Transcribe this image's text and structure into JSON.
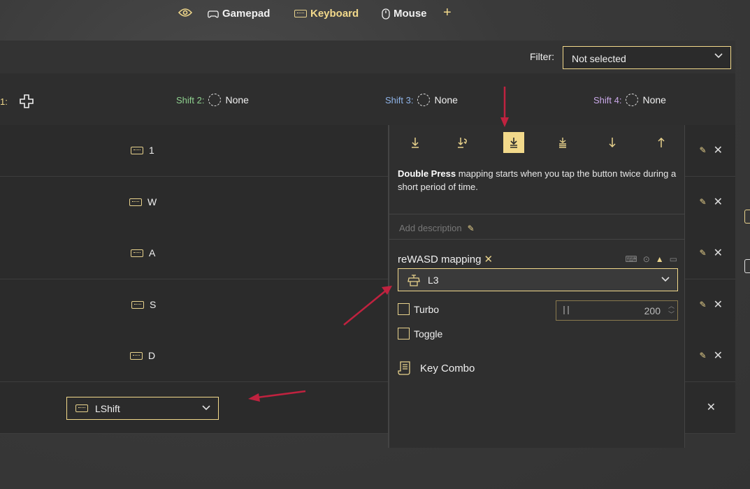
{
  "nav": {
    "items": [
      {
        "label": "Gamepad",
        "icon": "gamepad-icon"
      },
      {
        "label": "Keyboard",
        "icon": "keyboard-icon",
        "active": true
      },
      {
        "label": "Mouse",
        "icon": "mouse-icon"
      }
    ],
    "add_label": "+",
    "eye_icon": "eye-icon"
  },
  "filter": {
    "label": "Filter:",
    "value": "Not selected"
  },
  "shifts": {
    "shift1_suffix": "1:",
    "shift2_label": "Shift 2:",
    "shift2_value": "None",
    "shift3_label": "Shift 3:",
    "shift3_value": "None",
    "shift4_label": "Shift 4:",
    "shift4_value": "None",
    "colors": {
      "shift2": "#8fd18f",
      "shift3": "#8fb4e8",
      "shift4": "#c9a8e8"
    }
  },
  "rows": [
    {
      "key": "1"
    },
    {
      "key": "W"
    },
    {
      "key": "A"
    },
    {
      "key": "S"
    },
    {
      "key": "D"
    },
    {
      "key": "LShift"
    }
  ],
  "panel": {
    "tabs": [
      "single-press-icon",
      "long-press-icon",
      "double-press-icon",
      "triple-press-icon",
      "start-press-icon",
      "release-icon"
    ],
    "active_tab": 2,
    "desc_bold": "Double Press",
    "desc_text": " mapping starts when you tap the button twice during a short period of time.",
    "add_description": "Add description",
    "mapping_title": "reWASD mapping",
    "mapping_value": "L3",
    "turbo_label": "Turbo",
    "turbo_value": "200",
    "toggle_label": "Toggle",
    "key_combo_label": "Key Combo"
  },
  "colors": {
    "accent": "#f2d98b",
    "arrow": "#c0223f",
    "background": "#2b2b2b"
  }
}
